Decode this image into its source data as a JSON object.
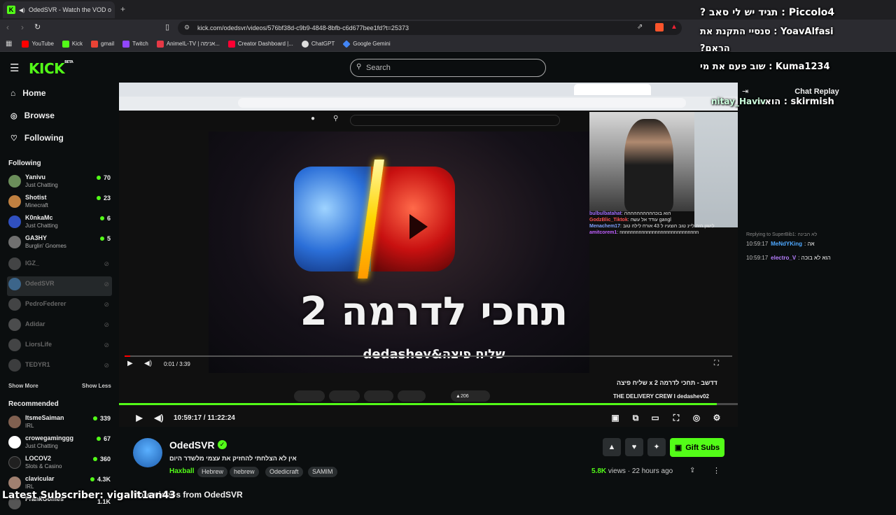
{
  "browser": {
    "tab_title": "OdedSVR - Watch the VOD o",
    "new_tab": "+",
    "url": "kick.com/odedsvr/videos/576bf38d-c9b9-4848-8bfb-c6d677bee1fd?t=25373",
    "bookmarks": [
      "YouTube",
      "Kick",
      "gmail",
      "Twitch",
      "AnimeIL-TV | אנימה...",
      "Creator Dashboard |...",
      "ChatGPT",
      "Google Gemini"
    ],
    "bookmark_colors": [
      "#ff0000",
      "#53fc18",
      "#ea4335",
      "#9146ff",
      "#e63946",
      "#ff0033",
      "#dddddd",
      "#4285f4"
    ]
  },
  "site": {
    "logo": "KICK",
    "logo_badge": "BETA",
    "search_placeholder": "Search"
  },
  "sidebar": {
    "nav": [
      {
        "label": "Home",
        "icon": "home-icon"
      },
      {
        "label": "Browse",
        "icon": "compass-icon"
      },
      {
        "label": "Following",
        "icon": "heart-icon"
      }
    ],
    "following_header": "Following",
    "following": [
      {
        "name": "Yanivu",
        "category": "Just Chatting",
        "viewers": "70",
        "live": true,
        "color": "#6b8e5a"
      },
      {
        "name": "Shotist",
        "category": "Minecraft",
        "viewers": "23",
        "live": true,
        "color": "#c08040"
      },
      {
        "name": "K0nkaMc",
        "category": "Just Chatting",
        "viewers": "6",
        "live": true,
        "color": "#3050c0"
      },
      {
        "name": "GA3HY",
        "category": "Burglin' Gnomes",
        "viewers": "5",
        "live": true,
        "color": "#707070"
      },
      {
        "name": "IGZ_",
        "category": "",
        "viewers": "",
        "live": false,
        "color": "#888"
      },
      {
        "name": "OdedSVR",
        "category": "",
        "viewers": "",
        "live": false,
        "color": "#5ab0ff"
      },
      {
        "name": "PedroFederer",
        "category": "",
        "viewers": "",
        "live": false,
        "color": "#888"
      },
      {
        "name": "Adidar",
        "category": "",
        "viewers": "",
        "live": false,
        "color": "#999"
      },
      {
        "name": "LiorsLife",
        "category": "",
        "viewers": "",
        "live": false,
        "color": "#888"
      },
      {
        "name": "TEDYR1",
        "category": "",
        "viewers": "",
        "live": false,
        "color": "#777"
      }
    ],
    "show_more": "Show More",
    "show_less": "Show Less",
    "recommended_header": "Recommended",
    "recommended": [
      {
        "name": "ItsmeSaiman",
        "category": "IRL",
        "viewers": "339",
        "color": "#806050"
      },
      {
        "name": "crowegaminggg",
        "category": "Just Chatting",
        "viewers": "67",
        "color": "#ffffff"
      },
      {
        "name": "LOCOV2",
        "category": "Slots & Casino",
        "viewers": "360",
        "color": "#202020"
      },
      {
        "name": "clavicular",
        "category": "IRL",
        "viewers": "4.3K",
        "color": "#a08070"
      },
      {
        "name": "FrankGomes",
        "category": "",
        "viewers": "1.1K",
        "color": "#555"
      }
    ]
  },
  "player": {
    "inner_video_title": "תחכי לדרמה 2",
    "inner_video_subtitle": "dedashev&שליח פיצה",
    "inner_time": "0:01 / 3:39",
    "inner_channel": "THE DELIVERY CREW I dedashev02",
    "inner_title_line": "שליח פיצה x דדשב - תחכי לדרמה 2",
    "inner_likes": "206",
    "inner_chat": [
      {
        "user": "bulbulbatahat",
        "text": "הוא בוכהההההההההה",
        "color": "#a070ff"
      },
      {
        "user": "GodzBlic_Tiktok",
        "text": "עודד אל עשה gangl",
        "color": "#ff5050"
      },
      {
        "user": "Menachem17",
        "text": "לישון היה ליינ טוב הוצעיו ל 43 אורח לילה טוב",
        "color": "#7fa0ff"
      },
      {
        "user": "amitcorem1",
        "text": "nnnnnnnnnnnnnnnnnnnnnnnnnnnnn",
        "color": "#c060ff"
      }
    ],
    "elapsed": "10:59:17",
    "duration": "11:22:24",
    "progress": 0.966
  },
  "chat": {
    "title": "Chat Replay",
    "messages": [
      {
        "time": "10:59:17",
        "user": "MeNdYKing",
        "text": "אה",
        "color": "#4ea8ff",
        "reply": "Replying to SuperBib1: לא הבינה"
      },
      {
        "time": "10:59:17",
        "user": "electro_V",
        "text": "הוא לא בוכה",
        "color": "#b67fff",
        "reply": ""
      }
    ]
  },
  "overlay": {
    "line1": "? תגיד יש לי סאב : Piccolo4",
    "line2": "סנסיי התקנת את : YoavAlfasi",
    "line3": "?הראם",
    "line4": "שוב פעם את מי : Kuma1234",
    "line5": "הוא ר : skirmish",
    "line6": "nitay_Haviv",
    "footer": "Latest Subscriber: vigalit1an43"
  },
  "channel": {
    "name": "OdedSVR",
    "title": "אין לא הצלחתי להחזיק את עצמי מלשדר היום",
    "category": "Haxball",
    "tags": [
      "Hebrew",
      "hebrew",
      "Odedicraft",
      "SAMIM"
    ],
    "gift_label": "Gift Subs",
    "views": "5.8K",
    "views_label": "views",
    "age": "22 hours ago",
    "more_videos": "More videos from OdedSVR"
  }
}
